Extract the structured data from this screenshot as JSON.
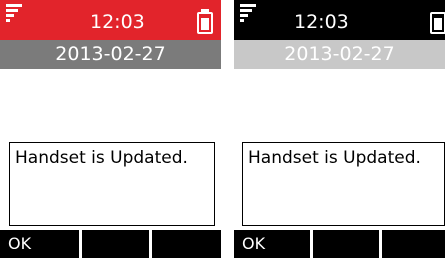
{
  "screens": [
    {
      "theme": "red",
      "colors": {
        "status_bar": "#e2242b",
        "date_bar": "#7b7b7b"
      },
      "status": {
        "time": "12:03",
        "signal_icon": "signal-icon",
        "battery_icon": "battery-icon"
      },
      "date": "2013-02-27",
      "message": "Handset is Updated.",
      "softkeys": [
        "OK",
        "",
        ""
      ]
    },
    {
      "theme": "black",
      "colors": {
        "status_bar": "#000000",
        "date_bar": "#c8c8c8"
      },
      "status": {
        "time": "12:03",
        "signal_icon": "signal-icon",
        "battery_icon": "battery-icon"
      },
      "date": "2013-02-27",
      "message": "Handset is Updated.",
      "softkeys": [
        "OK",
        "",
        ""
      ]
    }
  ]
}
